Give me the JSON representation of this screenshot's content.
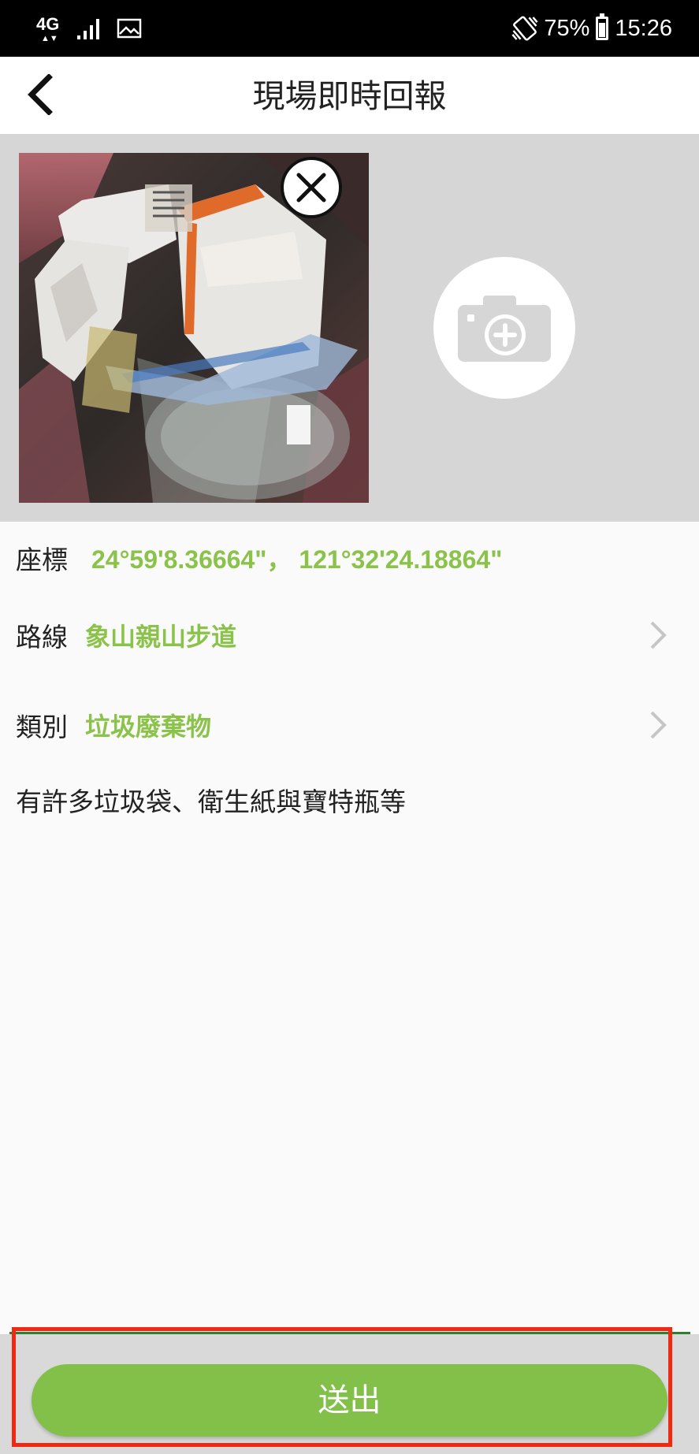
{
  "status_bar": {
    "network": "4G",
    "network_arrows": "▲▼",
    "battery": "75%",
    "time": "15:26",
    "icons": [
      "signal-icon",
      "gallery-icon",
      "vibrate-icon",
      "battery-icon"
    ]
  },
  "header": {
    "title": "現場即時回報",
    "back_icon": "chevron-left-icon"
  },
  "photo_section": {
    "photo": "trash-photo",
    "remove_icon": "close-circle-icon",
    "add_icon": "camera-plus-icon"
  },
  "fields": {
    "coordinates": {
      "label": "座標",
      "value": "24°59'8.36664\"， 121°32'24.18864\""
    },
    "route": {
      "label": "路線",
      "value": "象山親山步道"
    },
    "category": {
      "label": "類別",
      "value": "垃圾廢棄物"
    }
  },
  "description": "有許多垃圾袋、衛生紙與寶特瓶等",
  "submit": {
    "label": "送出"
  },
  "colors": {
    "accent": "#82c04a",
    "value_text": "#8bc34a",
    "highlight": "#f02a12",
    "divider": "#2e7d32"
  }
}
